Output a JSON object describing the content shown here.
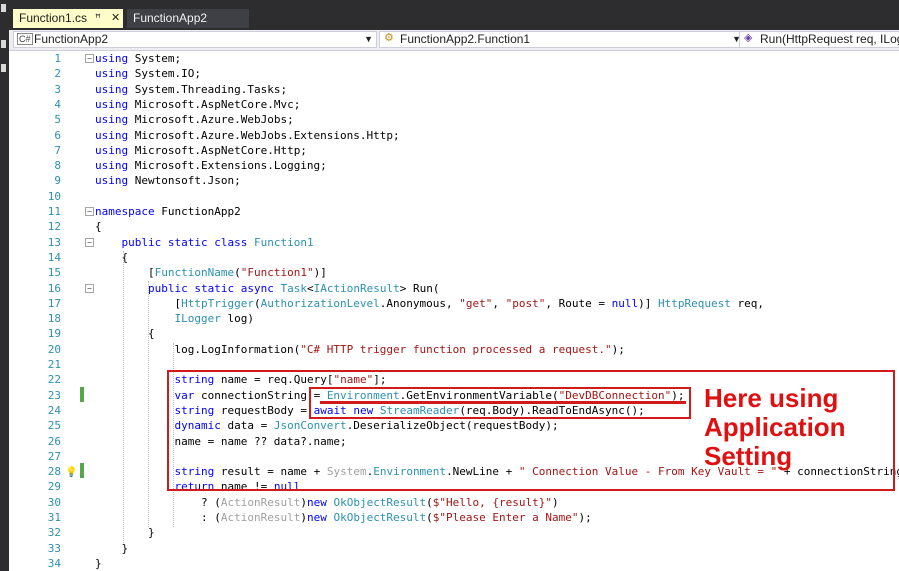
{
  "tabs": [
    {
      "label": "Function1.cs",
      "pin": "ꟸ",
      "close": "✕"
    },
    {
      "label": "FunctionApp2"
    }
  ],
  "navbar": {
    "project": "FunctionApp2",
    "class": "FunctionApp2.Function1",
    "member": "Run(HttpRequest req, ILogg"
  },
  "annotation": "Here using Application Setting",
  "code_lines": [
    {
      "n": "1",
      "html": "<span class='kw'>using</span> System;"
    },
    {
      "n": "2",
      "html": "<span class='kw'>using</span> System.IO;"
    },
    {
      "n": "3",
      "html": "<span class='kw'>using</span> System.Threading.Tasks;"
    },
    {
      "n": "4",
      "html": "<span class='kw'>using</span> Microsoft.AspNetCore.Mvc;"
    },
    {
      "n": "5",
      "html": "<span class='kw'>using</span> Microsoft.Azure.WebJobs;"
    },
    {
      "n": "6",
      "html": "<span class='kw'>using</span> Microsoft.Azure.WebJobs.Extensions.Http;"
    },
    {
      "n": "7",
      "html": "<span class='kw'>using</span> Microsoft.AspNetCore.Http;"
    },
    {
      "n": "8",
      "html": "<span class='kw'>using</span> Microsoft.Extensions.Logging;"
    },
    {
      "n": "9",
      "html": "<span class='kw'>using</span> Newtonsoft.Json;"
    },
    {
      "n": "10",
      "html": ""
    },
    {
      "n": "11",
      "html": "<span class='kw'>namespace</span> FunctionApp2"
    },
    {
      "n": "12",
      "html": "{"
    },
    {
      "n": "13",
      "html": "    <span class='kw'>public</span> <span class='kw'>static</span> <span class='kw'>class</span> <span class='ty'>Function1</span>"
    },
    {
      "n": "14",
      "html": "    {"
    },
    {
      "n": "15",
      "html": "        [<span class='ty'>FunctionName</span>(<span class='st'>\"Function1\"</span>)]"
    },
    {
      "n": "16",
      "html": "        <span class='kw'>public</span> <span class='kw'>static</span> <span class='kw'>async</span> <span class='ty'>Task</span>&lt;<span class='ty'>IActionResult</span>&gt; Run("
    },
    {
      "n": "17",
      "html": "            [<span class='ty'>HttpTrigger</span>(<span class='ty'>AuthorizationLevel</span>.Anonymous, <span class='st'>\"get\"</span>, <span class='st'>\"post\"</span>, Route = <span class='kw'>null</span>)] <span class='ty'>HttpRequest</span> req,"
    },
    {
      "n": "18",
      "html": "            <span class='ty'>ILogger</span> log)"
    },
    {
      "n": "19",
      "html": "        {"
    },
    {
      "n": "20",
      "html": "            log.LogInformation(<span class='st'>\"C# HTTP trigger function processed a request.\"</span>);"
    },
    {
      "n": "21",
      "html": ""
    },
    {
      "n": "22",
      "html": "            <span class='kw'>string</span> name = req.Query[<span class='st'>\"name\"</span>];"
    },
    {
      "n": "23",
      "html": "            <span class='kw'>var</span> connectionString = <span class='ty'>Environment</span>.GetEnvironmentVariable(<span class='st'>\"DevDBConnection\"</span>);"
    },
    {
      "n": "24",
      "html": "            <span class='kw'>string</span> requestBody = <span class='kw'>await</span> <span class='kw'>new</span> <span class='ty'>StreamReader</span>(req.Body).ReadToEndAsync();"
    },
    {
      "n": "25",
      "html": "            <span class='kw'>dynamic</span> data = <span class='ty'>JsonConvert</span>.DeserializeObject(requestBody);"
    },
    {
      "n": "26",
      "html": "            name = name ?? data?.name;"
    },
    {
      "n": "27",
      "html": ""
    },
    {
      "n": "28",
      "html": "            <span class='kw'>string</span> result = name + <span class='gy'>System</span>.<span class='ty'>Environment</span>.NewLine + <span class='st'>\" Connection Value - From Key Vault = \"</span> + connectionString;"
    },
    {
      "n": "29",
      "html": "            <span class='kw'>return</span> name != <span class='kw'>null</span>"
    },
    {
      "n": "30",
      "html": "                ? (<span class='gy'>ActionResult</span>)<span class='kw'>new</span> <span class='ty'>OkObjectResult</span>(<span class='st'>$\"Hello, {result}\"</span>)"
    },
    {
      "n": "31",
      "html": "                : (<span class='gy'>ActionResult</span>)<span class='kw'>new</span> <span class='ty'>OkObjectResult</span>(<span class='st'>$\"Please Enter a Name\"</span>);"
    },
    {
      "n": "32",
      "html": "        }"
    },
    {
      "n": "33",
      "html": "    }"
    },
    {
      "n": "34",
      "html": "}"
    }
  ]
}
